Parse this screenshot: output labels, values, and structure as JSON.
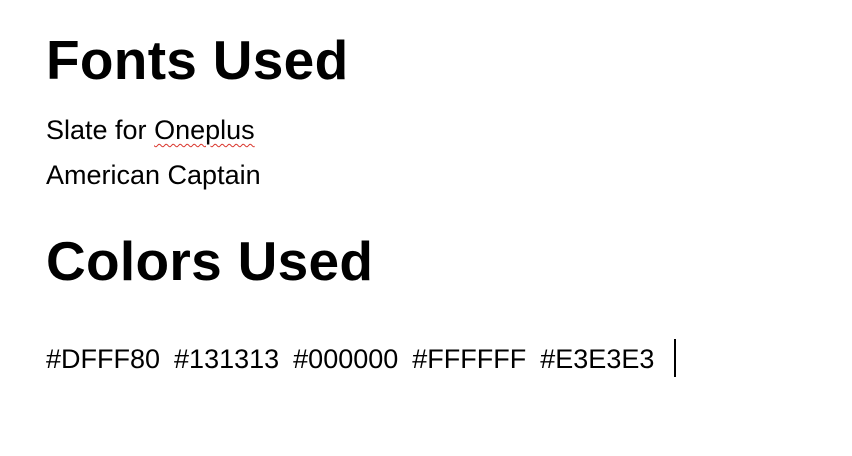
{
  "fonts_section": {
    "heading": "Fonts Used",
    "line1_prefix": "Slate for ",
    "line1_misspelled": "Oneplus",
    "line2": "American Captain"
  },
  "colors_section": {
    "heading": "Colors Used",
    "codes": [
      "#DFFF80",
      "#131313",
      "#000000",
      "#FFFFFF",
      "#E3E3E3"
    ]
  },
  "ui_colors": {
    "text": "#000000",
    "spellcheck_underline": "#d9342b",
    "background": "#ffffff"
  }
}
